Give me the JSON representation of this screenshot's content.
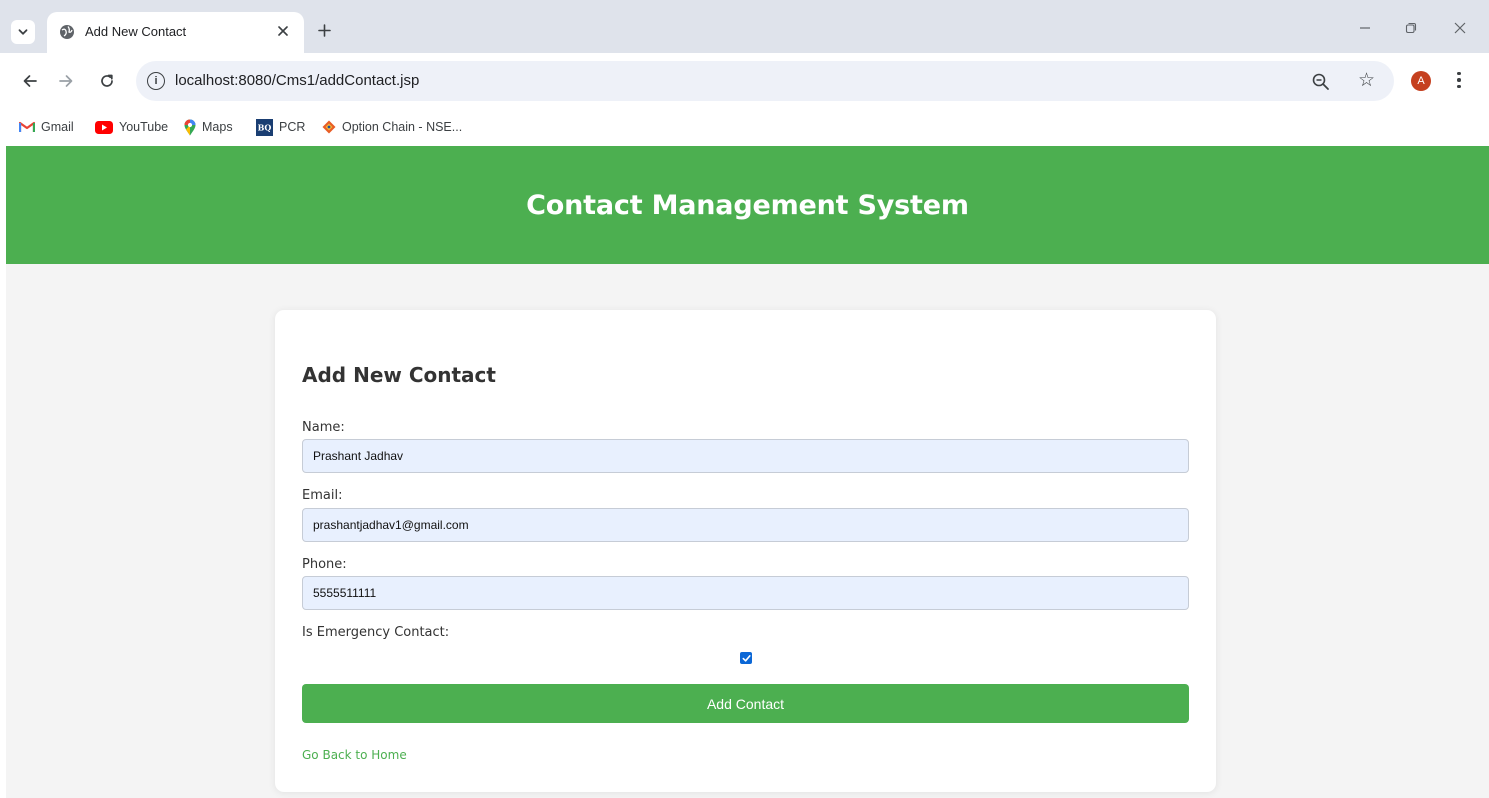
{
  "browser": {
    "tab": {
      "title": "Add New Contact"
    },
    "address_bar": {
      "url": "localhost:8080/Cms1/addContact.jsp"
    },
    "profile": {
      "initial": "A",
      "color": "#c5401f"
    },
    "bookmarks": [
      {
        "label": "Gmail",
        "icon": "gmail-icon"
      },
      {
        "label": "YouTube",
        "icon": "youtube-icon"
      },
      {
        "label": "Maps",
        "icon": "maps-icon"
      },
      {
        "label": "PCR",
        "icon": "bq-icon"
      },
      {
        "label": "Option Chain - NSE...",
        "icon": "nse-icon"
      }
    ]
  },
  "page": {
    "header_title": "Contact Management System",
    "header_color": "#4caf50",
    "form": {
      "title": "Add New Contact",
      "name_label": "Name:",
      "name_value": "Prashant Jadhav",
      "email_label": "Email:",
      "email_value": "prashantjadhav1@gmail.com",
      "phone_label": "Phone:",
      "phone_value": "5555511111",
      "emergency_label": "Is Emergency Contact:",
      "emergency_checked": true,
      "submit_label": "Add Contact",
      "back_link": "Go Back to Home"
    }
  }
}
